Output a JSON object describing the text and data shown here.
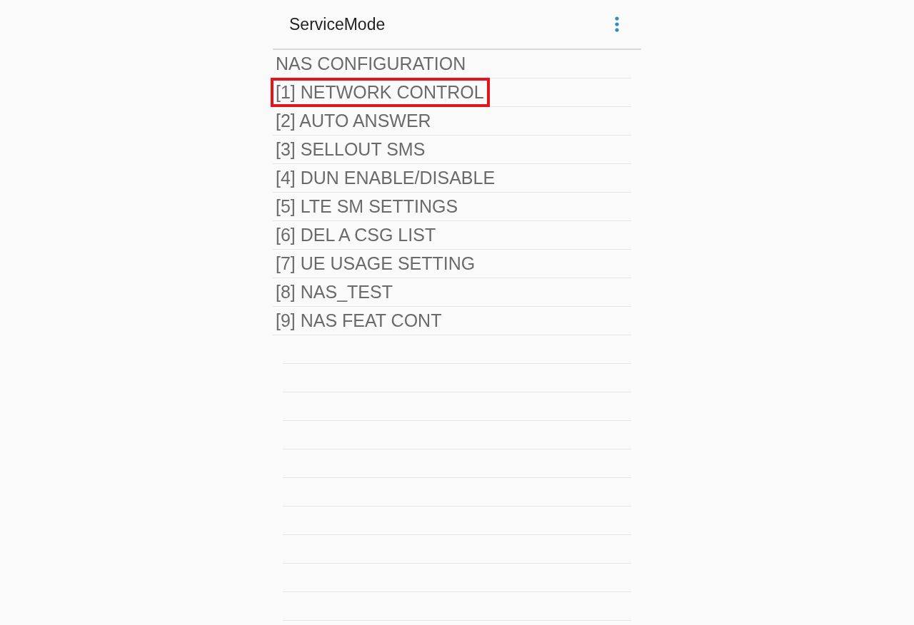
{
  "app_bar": {
    "title": "ServiceMode"
  },
  "items": [
    {
      "label": "NAS CONFIGURATION",
      "highlighted": false
    },
    {
      "label": "[1] NETWORK CONTROL",
      "highlighted": true
    },
    {
      "label": "[2] AUTO ANSWER",
      "highlighted": false
    },
    {
      "label": "[3] SELLOUT SMS",
      "highlighted": false
    },
    {
      "label": "[4] DUN ENABLE/DISABLE",
      "highlighted": false
    },
    {
      "label": "[5] LTE SM SETTINGS",
      "highlighted": false
    },
    {
      "label": "[6] DEL A CSG LIST",
      "highlighted": false
    },
    {
      "label": "[7] UE USAGE SETTING",
      "highlighted": false
    },
    {
      "label": "[8] NAS_TEST",
      "highlighted": false
    },
    {
      "label": "[9] NAS FEAT CONT",
      "highlighted": false
    }
  ]
}
